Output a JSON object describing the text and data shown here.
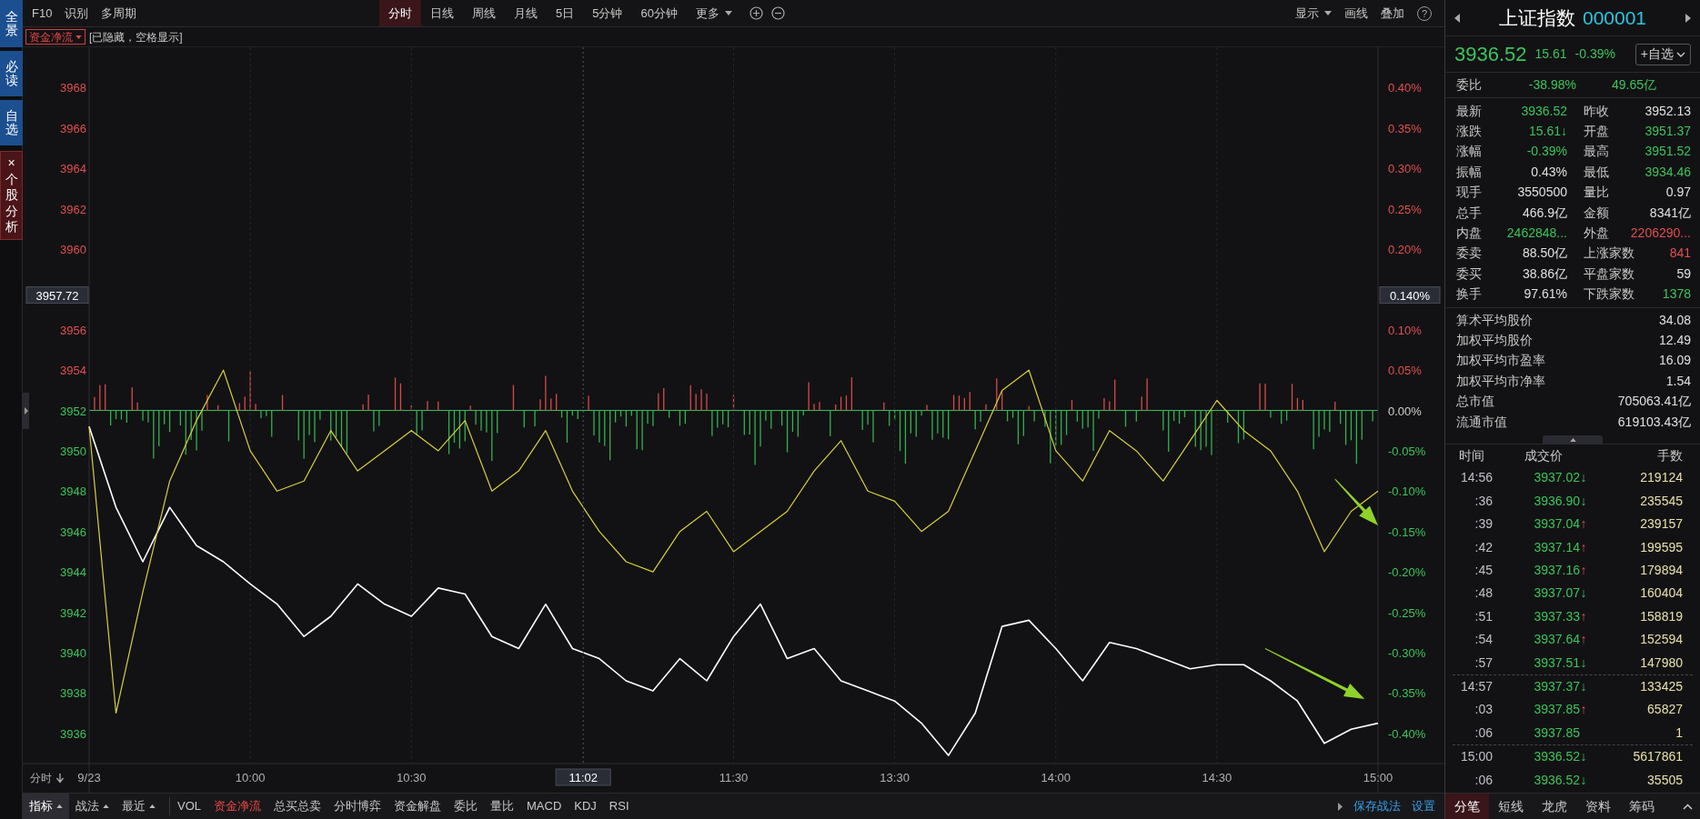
{
  "sidebar": [
    {
      "label": "全景",
      "kind": "nav",
      "selected": false
    },
    {
      "label": "必读",
      "kind": "nav",
      "selected": false
    },
    {
      "label": "自选",
      "kind": "nav",
      "selected": false
    },
    {
      "label": "个股分析",
      "kind": "closable",
      "close_mark": "×",
      "selected": true
    }
  ],
  "toolbar": {
    "left": [
      "F10",
      "识别",
      "多周期"
    ],
    "periods": [
      {
        "label": "分时",
        "selected": true,
        "dropdown": false
      },
      {
        "label": "日线",
        "selected": false,
        "dropdown": false
      },
      {
        "label": "周线",
        "selected": false,
        "dropdown": false
      },
      {
        "label": "月线",
        "selected": false,
        "dropdown": false
      },
      {
        "label": "5日",
        "selected": false,
        "dropdown": false
      },
      {
        "label": "5分钟",
        "selected": false,
        "dropdown": false
      },
      {
        "label": "60分钟",
        "selected": false,
        "dropdown": false
      },
      {
        "label": "更多",
        "selected": false,
        "dropdown": true
      }
    ],
    "right": [
      {
        "label": "显示",
        "dropdown": true
      },
      {
        "label": "画线",
        "dropdown": false
      },
      {
        "label": "叠加",
        "dropdown": false
      }
    ],
    "help": "?"
  },
  "indicator_bar": {
    "selector": "资金净流",
    "note": "[已隐藏，空格显示]"
  },
  "chart": {
    "corner_label": "分时",
    "percent_axis": [
      {
        "label": "0.40%",
        "color": "#e05050"
      },
      {
        "label": "0.35%",
        "color": "#e05050"
      },
      {
        "label": "0.30%",
        "color": "#e05050"
      },
      {
        "label": "0.25%",
        "color": "#e05050"
      },
      {
        "label": "0.20%",
        "color": "#e05050"
      },
      {
        "label": "0.10%",
        "color": "#e05050"
      },
      {
        "label": "0.05%",
        "color": "#e05050"
      },
      {
        "label": "0.00%",
        "color": "#d0d0d0"
      },
      {
        "label": "-0.05%",
        "color": "#3cc45a"
      },
      {
        "label": "-0.10%",
        "color": "#3cc45a"
      },
      {
        "label": "-0.15%",
        "color": "#3cc45a"
      },
      {
        "label": "-0.20%",
        "color": "#3cc45a"
      },
      {
        "label": "-0.25%",
        "color": "#3cc45a"
      },
      {
        "label": "-0.30%",
        "color": "#3cc45a"
      },
      {
        "label": "-0.35%",
        "color": "#3cc45a"
      },
      {
        "label": "-0.40%",
        "color": "#3cc45a"
      }
    ],
    "crosshair": {
      "price": "3957.72",
      "percent": "0.140%",
      "time": "11:02"
    },
    "chart_data": {
      "type": "line",
      "categories": [
        "9/23",
        null,
        null,
        null,
        null,
        null,
        "10:00",
        null,
        null,
        null,
        null,
        null,
        "10:30",
        null,
        null,
        null,
        null,
        null,
        null,
        null,
        null,
        null,
        null,
        null,
        "11:30",
        null,
        null,
        null,
        null,
        null,
        "13:30",
        null,
        null,
        null,
        null,
        null,
        "14:00",
        null,
        null,
        null,
        null,
        null,
        "14:30",
        null,
        null,
        null,
        null,
        null,
        "15:00"
      ],
      "series": [
        {
          "color": "#ffffff",
          "values": [
            3951.2,
            3947.2,
            3944.5,
            3947.2,
            3945.3,
            3944.5,
            3943.4,
            3942.4,
            3940.8,
            3941.8,
            3943.4,
            3942.4,
            3941.8,
            3943.2,
            3942.9,
            3940.8,
            3940.2,
            3942.4,
            3940.2,
            3939.7,
            3938.6,
            3938.1,
            3939.7,
            3938.6,
            3940.8,
            3942.4,
            3939.7,
            3940.2,
            3938.6,
            3938.1,
            3937.6,
            3936.5,
            3934.9,
            3937.0,
            3941.3,
            3941.6,
            3940.2,
            3938.6,
            3940.5,
            3940.2,
            3939.7,
            3939.2,
            3939.4,
            3939.4,
            3938.6,
            3937.6,
            3935.5,
            3936.2,
            3936.5
          ]
        },
        {
          "color": "#d8d040",
          "values": [
            3951.2,
            3937.0,
            3943.0,
            3948.5,
            3951.5,
            3954.0,
            3950.0,
            3948.0,
            3948.5,
            3951.0,
            3949.0,
            3950.0,
            3951.0,
            3950.0,
            3951.5,
            3948.0,
            3949.0,
            3951.0,
            3948.0,
            3946.0,
            3944.5,
            3944.0,
            3946.0,
            3947.0,
            3945.0,
            3946.0,
            3947.0,
            3949.0,
            3950.5,
            3948.0,
            3947.5,
            3946.0,
            3947.0,
            3950.0,
            3953.0,
            3954.0,
            3950.0,
            3948.5,
            3951.0,
            3950.0,
            3948.5,
            3950.5,
            3952.5,
            3951.0,
            3950.0,
            3948.0,
            3945.0,
            3947.0,
            3948.0
          ]
        }
      ],
      "ylim": [
        3934.5,
        3970
      ],
      "grid": true,
      "yticks": [
        3968,
        3966,
        3964,
        3962,
        3960,
        3956,
        3954,
        3952,
        3950,
        3948,
        3946,
        3944,
        3942,
        3940,
        3938,
        3936
      ]
    }
  },
  "bottom_bar": {
    "menus": [
      {
        "label": "指标",
        "selected": true
      },
      {
        "label": "战法",
        "selected": false
      },
      {
        "label": "最近",
        "selected": false
      }
    ],
    "indicators": [
      {
        "label": "VOL",
        "selected": false
      },
      {
        "label": "资金净流",
        "selected": true
      },
      {
        "label": "总买总卖",
        "selected": false
      },
      {
        "label": "分时博弈",
        "selected": false
      },
      {
        "label": "资金解盘",
        "selected": false
      },
      {
        "label": "委比",
        "selected": false
      },
      {
        "label": "量比",
        "selected": false
      },
      {
        "label": "MACD",
        "selected": false
      },
      {
        "label": "KDJ",
        "selected": false
      },
      {
        "label": "RSI",
        "selected": false
      }
    ],
    "links": [
      "保存战法",
      "设置"
    ]
  },
  "quote": {
    "name": "上证指数",
    "code": "000001",
    "rising": false,
    "price": "3936.52",
    "change": "15.61",
    "change_pct": "-0.39%",
    "watch_button": "+自选",
    "ratio_label": "委比",
    "ratio": "-38.98%",
    "ratio_amount": "49.65亿",
    "stats": [
      {
        "label": "最新",
        "value": "3936.52",
        "color": "#3cc45a"
      },
      {
        "label": "昨收",
        "value": "3952.13",
        "color": "#e0e0e0"
      },
      {
        "label": "涨跌",
        "value": "15.61↓",
        "color": "#3cc45a"
      },
      {
        "label": "开盘",
        "value": "3951.37",
        "color": "#3cc45a"
      },
      {
        "label": "涨幅",
        "value": "-0.39%",
        "color": "#3cc45a"
      },
      {
        "label": "最高",
        "value": "3951.52",
        "color": "#3cc45a"
      },
      {
        "label": "振幅",
        "value": "0.43%",
        "color": "#e0e0e0"
      },
      {
        "label": "最低",
        "value": "3934.46",
        "color": "#3cc45a"
      },
      {
        "label": "现手",
        "value": "3550500",
        "color": "#e0e0e0"
      },
      {
        "label": "量比",
        "value": "0.97",
        "color": "#e0e0e0"
      },
      {
        "label": "总手",
        "value": "466.9亿",
        "color": "#e0e0e0"
      },
      {
        "label": "金额",
        "value": "8341亿",
        "color": "#e0e0e0"
      },
      {
        "label": "内盘",
        "value": "2462848...",
        "color": "#3cc45a"
      },
      {
        "label": "外盘",
        "value": "2206290...",
        "color": "#e05050"
      },
      {
        "label": "委卖",
        "value": "88.50亿",
        "color": "#e0e0e0"
      },
      {
        "label": "上涨家数",
        "value": "841",
        "color": "#e05050"
      },
      {
        "label": "委买",
        "value": "38.86亿",
        "color": "#e0e0e0"
      },
      {
        "label": "平盘家数",
        "value": "59",
        "color": "#e0e0e0"
      },
      {
        "label": "换手",
        "value": "97.61%",
        "color": "#e0e0e0"
      },
      {
        "label": "下跌家数",
        "value": "1378",
        "color": "#3cc45a"
      }
    ],
    "summary": [
      {
        "label": "算术平均股价",
        "value": "34.08"
      },
      {
        "label": "加权平均股价",
        "value": "12.49"
      },
      {
        "label": "加权平均市盈率",
        "value": "16.09"
      },
      {
        "label": "加权平均市净率",
        "value": "1.54"
      },
      {
        "label": "总市值",
        "value": "705063.41亿"
      },
      {
        "label": "流通市值",
        "value": "619103.43亿"
      }
    ],
    "trades": {
      "columns": [
        "时间",
        "成交价",
        "手数"
      ],
      "groups": [
        {
          "rows": [
            {
              "time": "14:56",
              "price": "3937.02",
              "arrow": "↓",
              "rising": false,
              "volume": "219124"
            },
            {
              "time": ":36",
              "price": "3936.90",
              "arrow": "↓",
              "rising": false,
              "volume": "235545"
            },
            {
              "time": ":39",
              "price": "3937.04",
              "arrow": "↑",
              "rising": true,
              "volume": "239157"
            },
            {
              "time": ":42",
              "price": "3937.14",
              "arrow": "↑",
              "rising": true,
              "volume": "199595"
            },
            {
              "time": ":45",
              "price": "3937.16",
              "arrow": "↑",
              "rising": true,
              "volume": "179894"
            },
            {
              "time": ":48",
              "price": "3937.07",
              "arrow": "↓",
              "rising": false,
              "volume": "160404"
            },
            {
              "time": ":51",
              "price": "3937.33",
              "arrow": "↑",
              "rising": true,
              "volume": "158819"
            },
            {
              "time": ":54",
              "price": "3937.64",
              "arrow": "↑",
              "rising": true,
              "volume": "152594"
            },
            {
              "time": ":57",
              "price": "3937.51",
              "arrow": "↓",
              "rising": false,
              "volume": "147980"
            }
          ]
        },
        {
          "rows": [
            {
              "time": "14:57",
              "price": "3937.37",
              "arrow": "↓",
              "rising": false,
              "volume": "133425"
            },
            {
              "time": ":03",
              "price": "3937.85",
              "arrow": "↑",
              "rising": true,
              "volume": "65827"
            },
            {
              "time": ":06",
              "price": "3937.85",
              "volume": "1"
            }
          ]
        },
        {
          "rows": [
            {
              "time": "15:00",
              "price": "3936.52",
              "arrow": "↓",
              "rising": false,
              "volume": "5617861"
            },
            {
              "time": ":06",
              "price": "3936.52",
              "arrow": "↓",
              "rising": false,
              "volume": "35505"
            }
          ]
        }
      ]
    },
    "tabs": [
      {
        "label": "分笔",
        "selected": true
      },
      {
        "label": "短线",
        "selected": false
      },
      {
        "label": "龙虎",
        "selected": false
      },
      {
        "label": "资料",
        "selected": false
      },
      {
        "label": "筹码",
        "selected": false
      }
    ]
  }
}
